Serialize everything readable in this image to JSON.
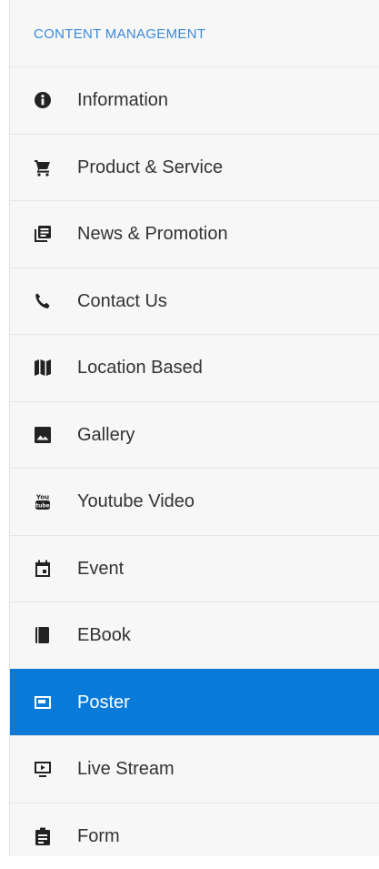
{
  "sidebar": {
    "section_title": "CONTENT MANAGEMENT",
    "accent_color": "#3b8ad9",
    "active_color": "#0a7ad9",
    "items": [
      {
        "label": "Information",
        "icon": "info-circle-icon",
        "active": false
      },
      {
        "label": "Product & Service",
        "icon": "shopping-cart-icon",
        "active": false
      },
      {
        "label": "News & Promotion",
        "icon": "newspaper-icon",
        "active": false
      },
      {
        "label": "Contact Us",
        "icon": "phone-icon",
        "active": false
      },
      {
        "label": "Location Based",
        "icon": "map-icon",
        "active": false
      },
      {
        "label": "Gallery",
        "icon": "image-icon",
        "active": false
      },
      {
        "label": "Youtube Video",
        "icon": "youtube-icon",
        "active": false
      },
      {
        "label": "Event",
        "icon": "calendar-icon",
        "active": false
      },
      {
        "label": "EBook",
        "icon": "book-icon",
        "active": false
      },
      {
        "label": "Poster",
        "icon": "poster-icon",
        "active": true
      },
      {
        "label": "Live Stream",
        "icon": "live-stream-icon",
        "active": false
      },
      {
        "label": "Form",
        "icon": "clipboard-icon",
        "active": false
      }
    ]
  }
}
